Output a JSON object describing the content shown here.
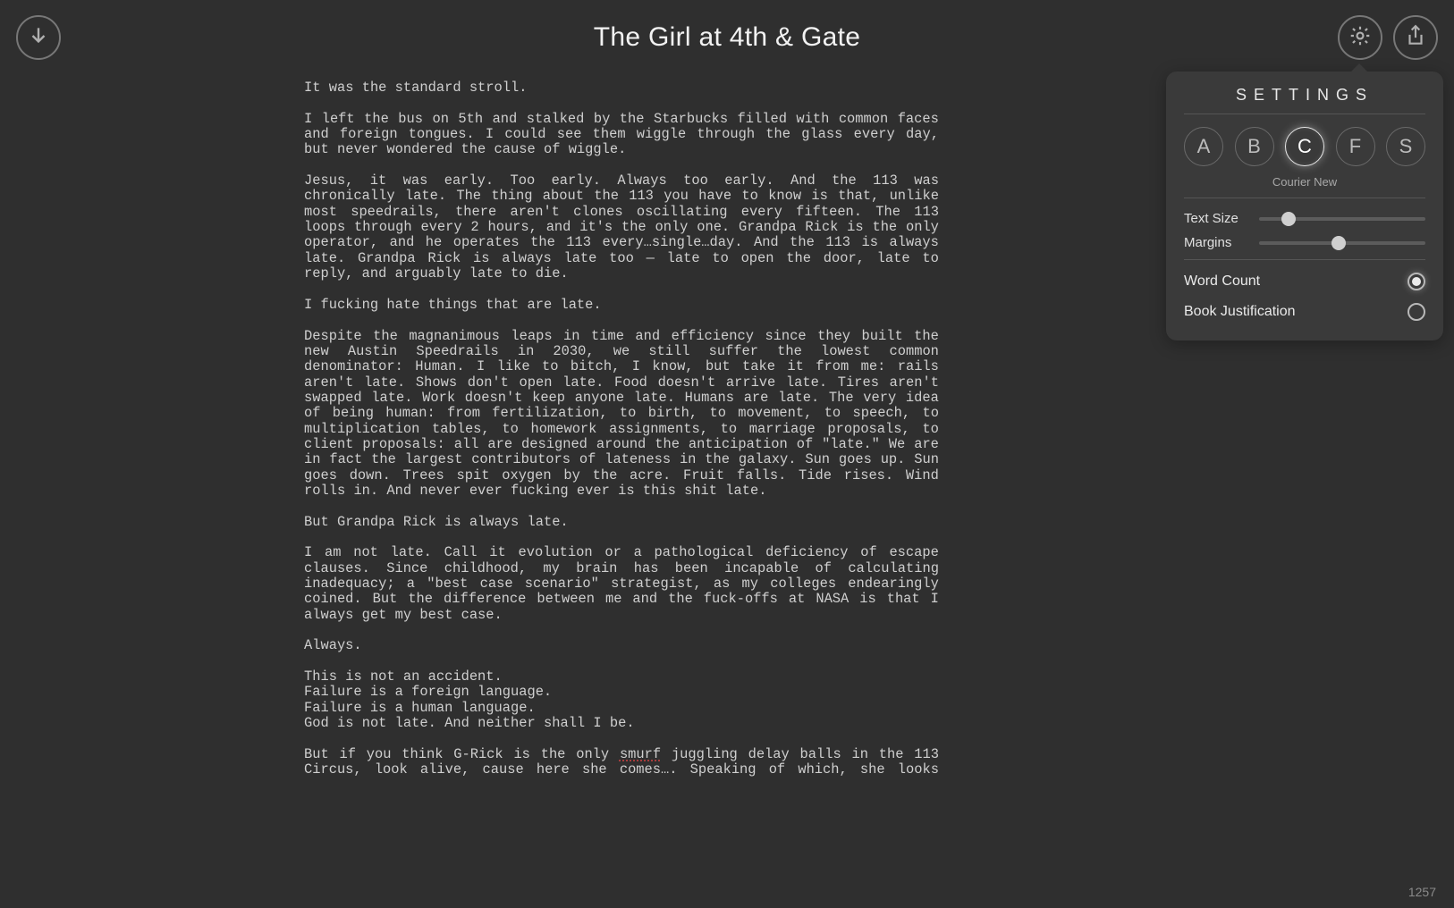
{
  "header": {
    "title": "The Girl at 4th & Gate"
  },
  "document": {
    "paragraphs": [
      "It was the standard stroll.",
      "",
      "I left the bus on 5th and stalked by the Starbucks filled with common faces and foreign tongues. I could see them wiggle through the glass every day, but never wondered the cause of wiggle.",
      "",
      "Jesus, it was early. Too early. Always too early. And the 113 was chronically late. The thing about the 113 you have to know is that, unlike most speedrails, there aren't clones oscillating every fifteen. The 113 loops through every 2 hours, and it's the only one. Grandpa Rick is the only operator, and he operates the 113 every…single…day. And the 113 is always late. Grandpa Rick is always late too — late to open the door, late to reply, and arguably late to die.",
      "",
      "I fucking hate things that are late.",
      "",
      "Despite the magnanimous leaps in time and efficiency since they built the new Austin Speedrails in 2030, we still suffer the lowest common denominator: Human. I like to bitch, I know, but take it from me: rails aren't late. Shows don't open late. Food doesn't arrive late. Tires aren't swapped late. Work doesn't keep anyone late. Humans are late. The very idea of being human: from fertilization, to birth, to movement, to speech, to multiplication tables, to homework assignments, to marriage proposals, to client proposals: all are designed around the anticipation of \"late.\" We are in fact the largest contributors of lateness in the galaxy. Sun goes up. Sun goes down. Trees spit oxygen by the acre. Fruit falls. Tide rises. Wind rolls in. And never ever fucking ever is this shit late.",
      "",
      "But Grandpa Rick is always late.",
      "",
      "I am not late. Call it evolution or a pathological deficiency of escape clauses. Since childhood, my brain has been incapable of calculating inadequacy; a \"best case scenario\" strategist, as my colleges endearingly coined. But the difference between me and the fuck-offs at NASA is that I always get my best case.",
      "",
      "Always.",
      "",
      "This is not an accident.",
      "Failure is a foreign language.",
      "Failure is a human language.",
      "God is not late. And neither shall I be.",
      "",
      "But if you think G-Rick is the only smurf juggling delay balls in the 113 Circus, look alive, cause here she comes…. Speaking of which, she looks stressed, and before you think it's because she has some domestic problems or family dysfunctions, let me at ease your peg: she's frazzled cause she ain't"
    ],
    "spellcheck_words": [
      "smurf"
    ]
  },
  "footer": {
    "word_count": "1257"
  },
  "settings": {
    "title": "SETTINGS",
    "fonts": {
      "options": [
        "A",
        "B",
        "C",
        "F",
        "S"
      ],
      "selected": "C",
      "selected_name": "Courier New"
    },
    "text_size": {
      "label": "Text Size",
      "value_pct": 18
    },
    "margins": {
      "label": "Margins",
      "value_pct": 48
    },
    "toggles": {
      "word_count": {
        "label": "Word Count",
        "on": true
      },
      "book_justification": {
        "label": "Book Justification",
        "on": false
      }
    }
  },
  "icons": {
    "download": "download-icon",
    "gear": "gear-icon",
    "share": "share-icon"
  }
}
